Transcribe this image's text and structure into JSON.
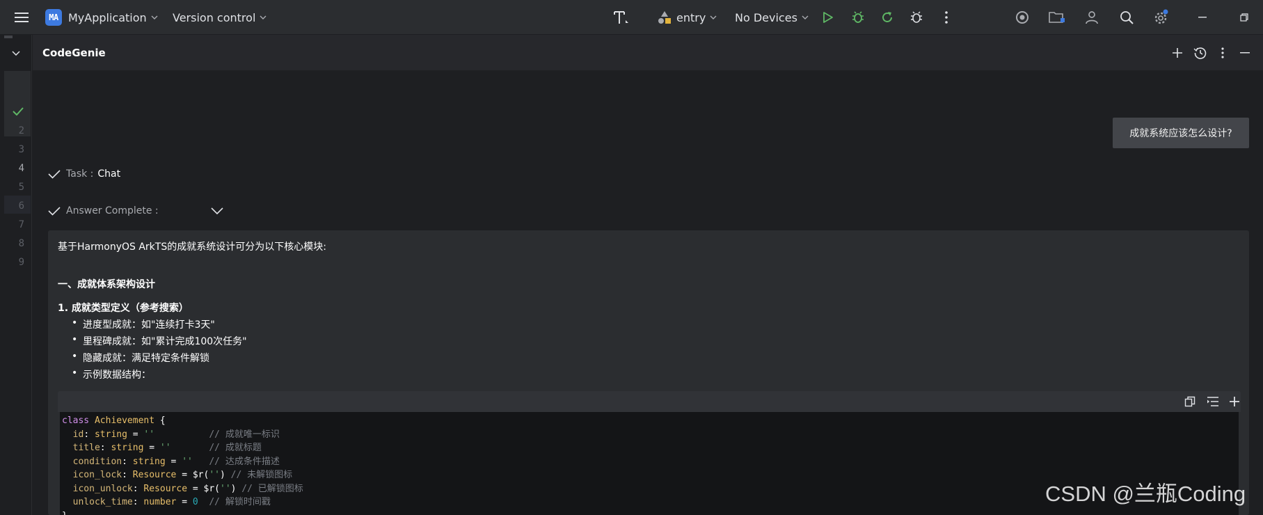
{
  "topbar": {
    "project_badge": "MA",
    "project_name": "MyApplication",
    "version_control": "Version control",
    "module": "entry",
    "devices": "No Devices"
  },
  "gutter": {
    "line_numbers": [
      "2",
      "3",
      "4",
      "5",
      "6",
      "7",
      "8",
      "9"
    ],
    "current_line": "4"
  },
  "panel": {
    "title": "CodeGenie",
    "user_message": "成就系统应该怎么设计?",
    "task_label": "Task :",
    "task_value": "Chat",
    "answer_label": "Answer Complete :"
  },
  "answer": {
    "intro": "基于HarmonyOS ArkTS的成就系统设计可分为以下核心模块:",
    "section1_heading": "一、成就体系架构设计",
    "item1_heading": "1. 成就类型定义（参考搜索）",
    "bullets": [
      "进度型成就：如\"连续打卡3天\"",
      "里程碑成就：如\"累计完成100次任务\"",
      "隐藏成就：满足特定条件解锁",
      "示例数据结构："
    ]
  },
  "code": {
    "lines": [
      {
        "parts": [
          [
            "kw",
            "class "
          ],
          [
            "ty",
            "Achievement"
          ],
          [
            "fn",
            " {"
          ]
        ]
      },
      {
        "parts": [
          [
            "pr",
            "  id"
          ],
          [
            "fn",
            ": "
          ],
          [
            "ty",
            "string"
          ],
          [
            "fn",
            " = "
          ],
          [
            "st",
            "''"
          ],
          [
            "cm",
            "          // 成就唯一标识"
          ]
        ]
      },
      {
        "parts": [
          [
            "pr",
            "  title"
          ],
          [
            "fn",
            ": "
          ],
          [
            "ty",
            "string"
          ],
          [
            "fn",
            " = "
          ],
          [
            "st",
            "''"
          ],
          [
            "cm",
            "       // 成就标题"
          ]
        ]
      },
      {
        "parts": [
          [
            "pr",
            "  condition"
          ],
          [
            "fn",
            ": "
          ],
          [
            "ty",
            "string"
          ],
          [
            "fn",
            " = "
          ],
          [
            "st",
            "''"
          ],
          [
            "cm",
            "   // 达成条件描述"
          ]
        ]
      },
      {
        "parts": [
          [
            "pr",
            "  icon_lock"
          ],
          [
            "fn",
            ": "
          ],
          [
            "ty",
            "Resource"
          ],
          [
            "fn",
            " = "
          ],
          [
            "fn",
            "$r("
          ],
          [
            "st",
            "''"
          ],
          [
            "fn",
            ")"
          ],
          [
            "cm",
            " // 未解锁图标"
          ]
        ]
      },
      {
        "parts": [
          [
            "pr",
            "  icon_unlock"
          ],
          [
            "fn",
            ": "
          ],
          [
            "ty",
            "Resource"
          ],
          [
            "fn",
            " = "
          ],
          [
            "fn",
            "$r("
          ],
          [
            "st",
            "''"
          ],
          [
            "fn",
            ")"
          ],
          [
            "cm",
            " // 已解锁图标"
          ]
        ]
      },
      {
        "parts": [
          [
            "pr",
            "  unlock_time"
          ],
          [
            "fn",
            ": "
          ],
          [
            "ty",
            "number"
          ],
          [
            "fn",
            " = "
          ],
          [
            "nu",
            "0"
          ],
          [
            "cm",
            "  // 解锁时间戳"
          ]
        ]
      },
      {
        "parts": [
          [
            "fn",
            "}"
          ]
        ]
      }
    ]
  },
  "watermark": "CSDN @兰瓶Coding",
  "colors": {
    "accent_green": "#5fb865",
    "badge_blue": "#3d7ae0",
    "notification_dot": "#3d7ae0"
  }
}
